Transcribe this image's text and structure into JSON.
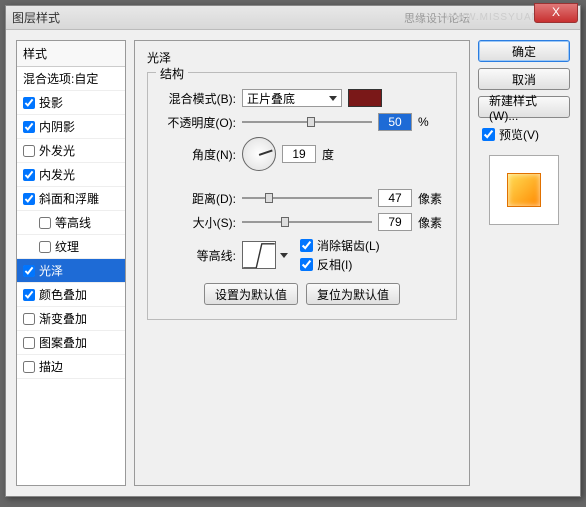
{
  "window": {
    "title": "图层样式"
  },
  "watermark1": "思缘设计论坛",
  "watermark2": "WWW.MISSYUAN.COM",
  "close_x": "X",
  "sidebar": {
    "header": "样式",
    "items": [
      {
        "label": "混合选项:自定",
        "checked": null
      },
      {
        "label": "投影",
        "checked": true
      },
      {
        "label": "内阴影",
        "checked": true
      },
      {
        "label": "外发光",
        "checked": false
      },
      {
        "label": "内发光",
        "checked": true
      },
      {
        "label": "斜面和浮雕",
        "checked": true
      },
      {
        "label": "等高线",
        "checked": false,
        "indent": true
      },
      {
        "label": "纹理",
        "checked": false,
        "indent": true
      },
      {
        "label": "光泽",
        "checked": true,
        "selected": true
      },
      {
        "label": "颜色叠加",
        "checked": true
      },
      {
        "label": "渐变叠加",
        "checked": false
      },
      {
        "label": "图案叠加",
        "checked": false
      },
      {
        "label": "描边",
        "checked": false
      }
    ]
  },
  "panel": {
    "title": "光泽",
    "fieldset": "结构",
    "blend_label": "混合模式(B):",
    "blend_value": "正片叠底",
    "color": "#7a1818",
    "opacity_label": "不透明度(O):",
    "opacity_value": "50",
    "percent": "%",
    "angle_label": "角度(N):",
    "angle_value": "19",
    "degree": "度",
    "distance_label": "距离(D):",
    "distance_value": "47",
    "px": "像素",
    "size_label": "大小(S):",
    "size_value": "79",
    "contour_label": "等高线:",
    "antialias": "消除锯齿(L)",
    "invert": "反相(I)",
    "btn_default": "设置为默认值",
    "btn_reset": "复位为默认值"
  },
  "right": {
    "ok": "确定",
    "cancel": "取消",
    "newstyle": "新建样式(W)...",
    "preview": "预览(V)"
  }
}
